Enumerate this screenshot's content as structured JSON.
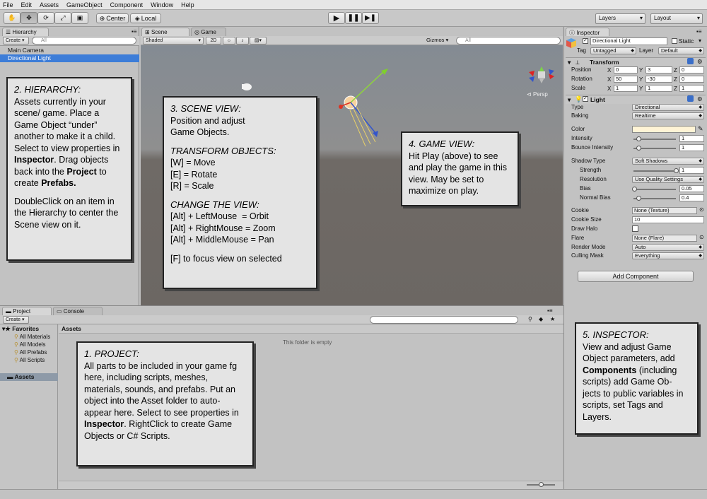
{
  "menu": [
    "File",
    "Edit",
    "Assets",
    "GameObject",
    "Component",
    "Window",
    "Help"
  ],
  "toolbar": {
    "pivot": "Center",
    "space": "Local",
    "layers": "Layers",
    "layout": "Layout"
  },
  "hierarchy": {
    "tab": "Hierarchy",
    "create": "Create",
    "search_placeholder": "All",
    "items": [
      "Main Camera",
      "Directional Light"
    ]
  },
  "scene": {
    "tab_scene": "Scene",
    "tab_game": "Game",
    "shaded": "Shaded",
    "mode2d": "2D",
    "gizmos": "Gizmos",
    "search_placeholder": "All",
    "persp": "Persp"
  },
  "project": {
    "tab_project": "Project",
    "tab_console": "Console",
    "create": "Create",
    "favorites_label": "Favorites",
    "favorites": [
      "All Materials",
      "All Models",
      "All Prefabs",
      "All Scripts"
    ],
    "assets_label": "Assets",
    "assets_header": "Assets",
    "empty_text": "This folder is empty"
  },
  "inspector": {
    "tab": "Inspector",
    "object_name": "Directional Light",
    "static_label": "Static",
    "tag_label": "Tag",
    "tag_value": "Untagged",
    "layer_label": "Layer",
    "layer_value": "Default",
    "transform": {
      "title": "Transform",
      "rows": [
        {
          "label": "Position",
          "x": "0",
          "y": "3",
          "z": "0"
        },
        {
          "label": "Rotation",
          "x": "50",
          "y": "-30",
          "z": "0"
        },
        {
          "label": "Scale",
          "x": "1",
          "y": "1",
          "z": "1"
        }
      ]
    },
    "light": {
      "title": "Light",
      "type_label": "Type",
      "type_value": "Directional",
      "baking_label": "Baking",
      "baking_value": "Realtime",
      "color_label": "Color",
      "color_value": "#fff4d6",
      "intensity_label": "Intensity",
      "intensity_value": "1",
      "intensity_fraction": 0.125,
      "bounce_label": "Bounce Intensity",
      "bounce_value": "1",
      "bounce_fraction": 0.125,
      "shadow_type_label": "Shadow Type",
      "shadow_type_value": "Soft Shadows",
      "strength_label": "Strength",
      "strength_value": "1",
      "strength_fraction": 1.0,
      "resolution_label": "Resolution",
      "resolution_value": "Use Quality Settings",
      "bias_label": "Bias",
      "bias_value": "0.05",
      "bias_fraction": 0.025,
      "normal_bias_label": "Normal Bias",
      "normal_bias_value": "0.4",
      "normal_bias_fraction": 0.13,
      "cookie_label": "Cookie",
      "cookie_value": "None (Texture)",
      "cookie_size_label": "Cookie Size",
      "cookie_size_value": "10",
      "draw_halo_label": "Draw Halo",
      "flare_label": "Flare",
      "flare_value": "None (Flare)",
      "render_mode_label": "Render Mode",
      "render_mode_value": "Auto",
      "culling_mask_label": "Culling Mask",
      "culling_mask_value": "Everything"
    },
    "add_component": "Add Component"
  },
  "notes": {
    "hierarchy": {
      "title": "2. HIERARCHY:",
      "p1_a": "Assets currently in your scene/ game. Place a Game Object “under” another to make it a child. Select to view properties in ",
      "p1_b": "Inspector",
      "p1_c": ". Drag objects back into the ",
      "p1_d": "Project",
      "p1_e": " to create ",
      "p1_f": "Prefabs.",
      "p2": "DoubleClick on an item in the Hierarchy to center the Scene view on it."
    },
    "scene": {
      "title": "3. SCENE VIEW:",
      "line1": "Position and adjust",
      "line2": "Game Objects.",
      "transform_title": "TRANSFORM OBJECTS:",
      "move": "[W] = Move",
      "rotate": "[E] = Rotate",
      "scale": "[R] = Scale",
      "view_title": "CHANGE THE VIEW:",
      "orbit": "[Alt] + LeftMouse  = Orbit",
      "zoom": "[Alt] + RightMouse = Zoom",
      "pan": "[Alt] + MiddleMouse = Pan",
      "focus": "[F] to focus view on selected"
    },
    "game": {
      "title": "4. GAME VIEW:",
      "text": "Hit Play (above) to see and play the game in this view. May be set to maximize on play."
    },
    "project": {
      "title": "1. PROJECT:",
      "a": "All parts to be included in your game fg here, including scripts, meshes, materials, sounds, and prefabs. Put an object into the Asset folder to auto- appear here. Select to see properties in ",
      "b": "Inspector",
      "c": ". RightClick to create Game Objects or C# Scripts."
    },
    "inspector": {
      "title": "5. INSPECTOR:",
      "a": "View and adjust Game Object parameters, add ",
      "b": "Components",
      "c": " (including scripts) add Game Ob- jects to public variables in scripts, set Tags and Layers."
    }
  }
}
